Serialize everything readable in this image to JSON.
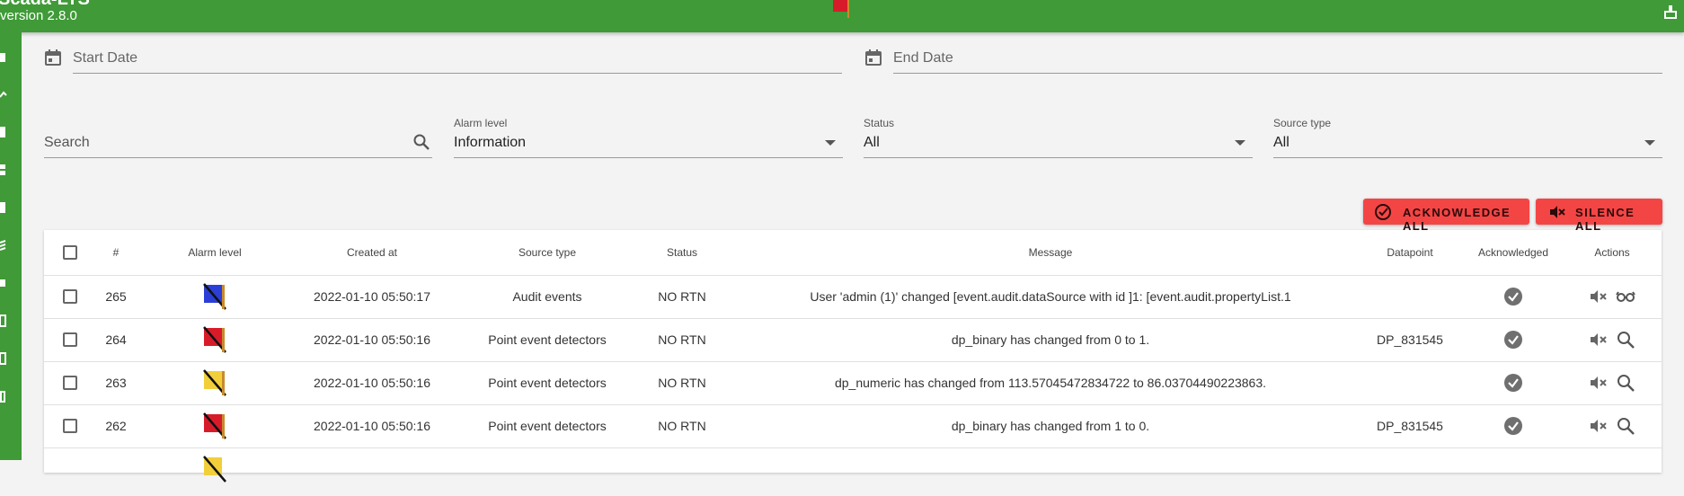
{
  "app": {
    "title": "Scada-LTS",
    "version": "version 2.8.0"
  },
  "filters": {
    "start_date": "Start Date",
    "end_date": "End Date",
    "search_label": "Search",
    "alarm_level_label": "Alarm level",
    "alarm_level_value": "Information",
    "status_label": "Status",
    "status_value": "All",
    "source_type_label": "Source type",
    "source_type_value": "All"
  },
  "buttons": {
    "acknowledge_all": "ACKNOWLEDGE ALL",
    "silence_all": "SILENCE ALL"
  },
  "table": {
    "headers": [
      "#",
      "Alarm level",
      "Created at",
      "Source type",
      "Status",
      "Message",
      "Datapoint",
      "Acknowledged",
      "Actions"
    ],
    "rows": [
      {
        "id": "265",
        "level": "information",
        "created": "2022-01-10 05:50:17",
        "source": "Audit events",
        "status": "NO RTN",
        "message": "User 'admin (1)' changed [event.audit.dataSource with id ]1: [event.audit.propertyList.1",
        "datapoint": "",
        "action2": "glasses-icon"
      },
      {
        "id": "264",
        "level": "urgent",
        "created": "2022-01-10 05:50:16",
        "source": "Point event detectors",
        "status": "NO RTN",
        "message": "dp_binary has changed from 0 to 1.",
        "datapoint": "DP_831545",
        "action2": "search-icon"
      },
      {
        "id": "263",
        "level": "important",
        "created": "2022-01-10 05:50:16",
        "source": "Point event detectors",
        "status": "NO RTN",
        "message": "dp_numeric has changed from 113.57045472834722 to 86.03704490223863.",
        "datapoint": "",
        "action2": "search-icon"
      },
      {
        "id": "262",
        "level": "urgent",
        "created": "2022-01-10 05:50:16",
        "source": "Point event detectors",
        "status": "NO RTN",
        "message": "dp_binary has changed from 1 to 0.",
        "datapoint": "DP_831545",
        "action2": "search-icon"
      }
    ]
  },
  "colors": {
    "primary": "#3f9a37",
    "danger": "#f44545",
    "flag_information": "#2b3fd6",
    "flag_urgent": "#d81b2a",
    "flag_important": "#f2cf3a"
  }
}
